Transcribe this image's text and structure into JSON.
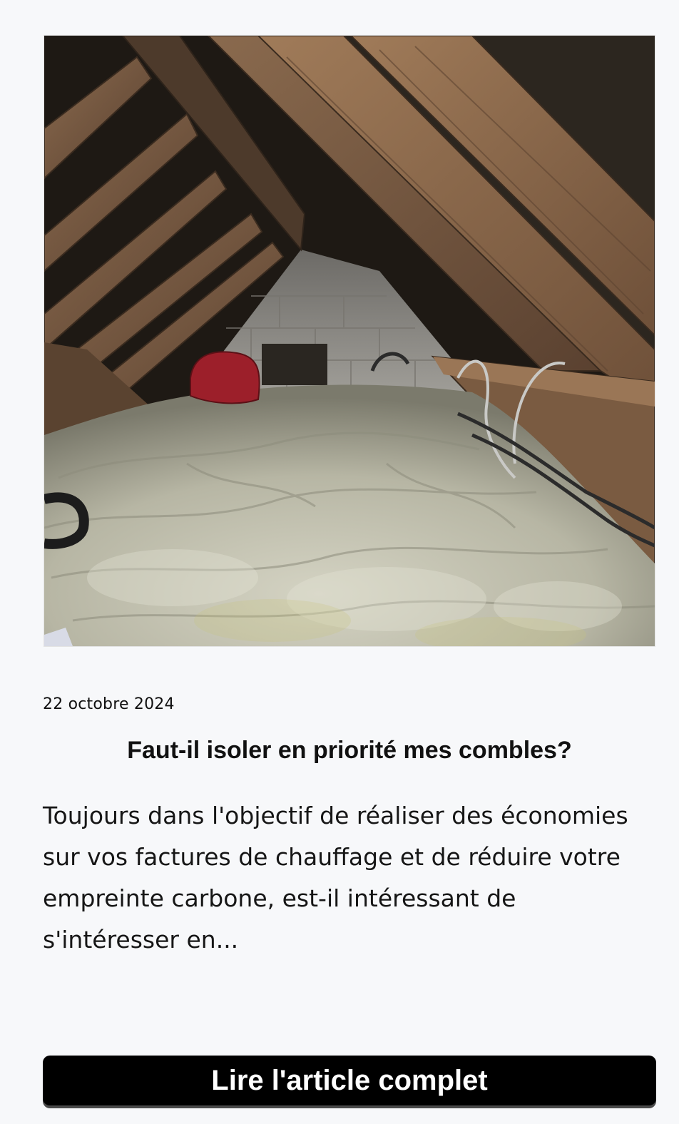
{
  "article": {
    "image_alt": "Combles isolés avec laine minérale sous la charpente en bois",
    "date": "22 octobre 2024",
    "title": "Faut-il isoler en priorité mes combles?",
    "excerpt": "Toujours dans l'objectif de réaliser des économies sur vos factures de chauffage et de réduire votre empreinte carbone, est-il intéressant de s'intéresser en...",
    "cta_label": "Lire l'article complet"
  },
  "colors": {
    "page_background": "#f7f8fa",
    "button_background": "#000000",
    "button_text": "#ffffff",
    "text": "#111111"
  }
}
